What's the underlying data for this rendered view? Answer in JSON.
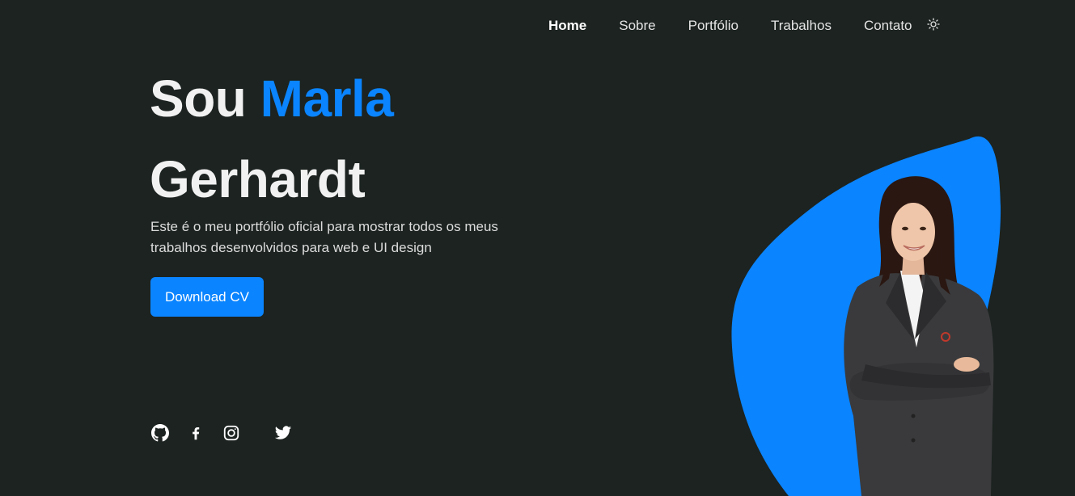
{
  "nav": {
    "items": [
      "Home",
      "Sobre",
      "Portfólio",
      "Trabalhos",
      "Contato"
    ],
    "active": "Home",
    "theme_toggle_icon": "sun-icon"
  },
  "hero": {
    "title_prefix": "Sou",
    "title_name_first": "Marla",
    "title_name_last": "Gerhardt",
    "description": "Este é o meu portfólio oficial para mostrar todos os meus trabalhos desenvolvidos para web e UI design",
    "cta_label": "Download CV"
  },
  "social": {
    "icons": [
      "github-icon",
      "facebook-icon",
      "instagram-icon",
      "twitter-icon"
    ]
  },
  "colors": {
    "background": "#1c2320",
    "accent": "#0a84ff",
    "text": "#f1f1f1"
  }
}
